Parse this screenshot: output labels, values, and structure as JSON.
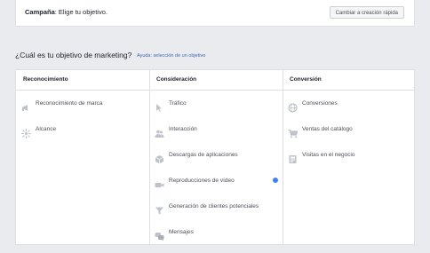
{
  "top": {
    "campaign_label": "Campaña",
    "campaign_text": ": Elige tu objetivo.",
    "quick_button": "Cambiar a creación rápida"
  },
  "heading": {
    "title": "¿Cuál es tu objetivo de marketing?",
    "help_link": "Ayuda: selección de un objetivo"
  },
  "columns": [
    {
      "title": "Reconocimiento",
      "items": [
        {
          "label": "Reconocimiento de marca",
          "icon": "megaphone-icon"
        },
        {
          "label": "Alcance",
          "icon": "reach-icon"
        }
      ]
    },
    {
      "title": "Consideración",
      "items": [
        {
          "label": "Tráfico",
          "icon": "cursor-icon"
        },
        {
          "label": "Interacción",
          "icon": "people-icon"
        },
        {
          "label": "Descargas de aplicaciones",
          "icon": "app-box-icon"
        },
        {
          "label": "Reproducciones de vídeo",
          "icon": "video-icon"
        },
        {
          "label": "Generación de clientes potenciales",
          "icon": "funnel-icon"
        },
        {
          "label": "Mensajes",
          "icon": "chat-bubbles-icon"
        }
      ]
    },
    {
      "title": "Conversión",
      "items": [
        {
          "label": "Conversiones",
          "icon": "globe-icon"
        },
        {
          "label": "Ventas del catálogo",
          "icon": "cart-icon"
        },
        {
          "label": "Visitas en el negocio",
          "icon": "store-icon"
        }
      ]
    }
  ],
  "colors": {
    "background": "#e9ebee",
    "icon_gray": "#bec2c9",
    "link_blue": "#4267b2",
    "info_blue": "#4080ff"
  }
}
